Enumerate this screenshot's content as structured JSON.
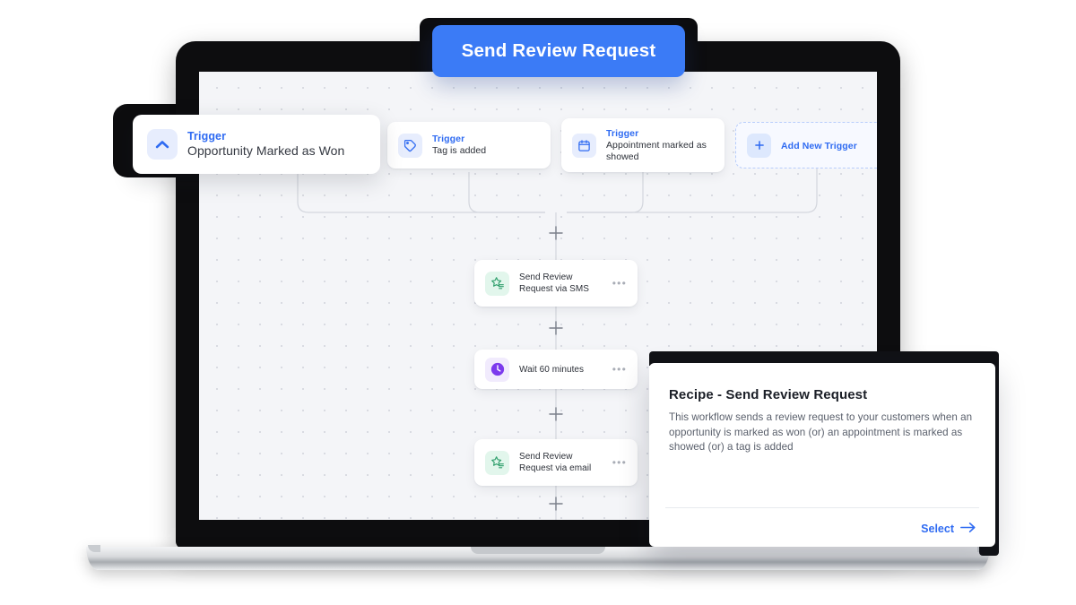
{
  "header": {
    "title": "Send Review Request",
    "accent": "#3b7bf6"
  },
  "featured_trigger": {
    "icon": "chevron-up-icon",
    "label": "Trigger",
    "name": "Opportunity Marked as Won"
  },
  "workflow": {
    "triggers": [
      {
        "icon": "chevron-up-icon",
        "label": "Trigger",
        "name": "Opportunity Marked as Won"
      },
      {
        "icon": "tag-icon",
        "label": "Trigger",
        "name": "Tag is added"
      },
      {
        "icon": "calendar-icon",
        "label": "Trigger",
        "name": "Appointment marked as showed"
      }
    ],
    "add_trigger": {
      "icon": "plus-icon",
      "label": "Add New Trigger"
    },
    "actions": [
      {
        "icon": "review-star-icon",
        "name": "Send Review Request via SMS",
        "menu": "•••"
      },
      {
        "icon": "clock-icon",
        "name": "Wait 60 minutes",
        "menu": "•••"
      },
      {
        "icon": "review-star-icon",
        "name": "Send Review Request via email",
        "menu": "•••"
      }
    ],
    "add_step_icon": "plus-node-icon"
  },
  "recipe": {
    "title": "Recipe - Send Review Request",
    "description": "This workflow sends a review request to your customers when an opportunity is marked as won (or) an appointment is marked as showed (or) a tag is added",
    "select_label": "Select",
    "select_icon": "arrow-right-icon"
  },
  "colors": {
    "brand_blue": "#2f6bf2",
    "title_blue": "#3b7bf6",
    "green": "#2e9e6b",
    "purple": "#7c3aed",
    "canvas": "#f4f5f8"
  }
}
